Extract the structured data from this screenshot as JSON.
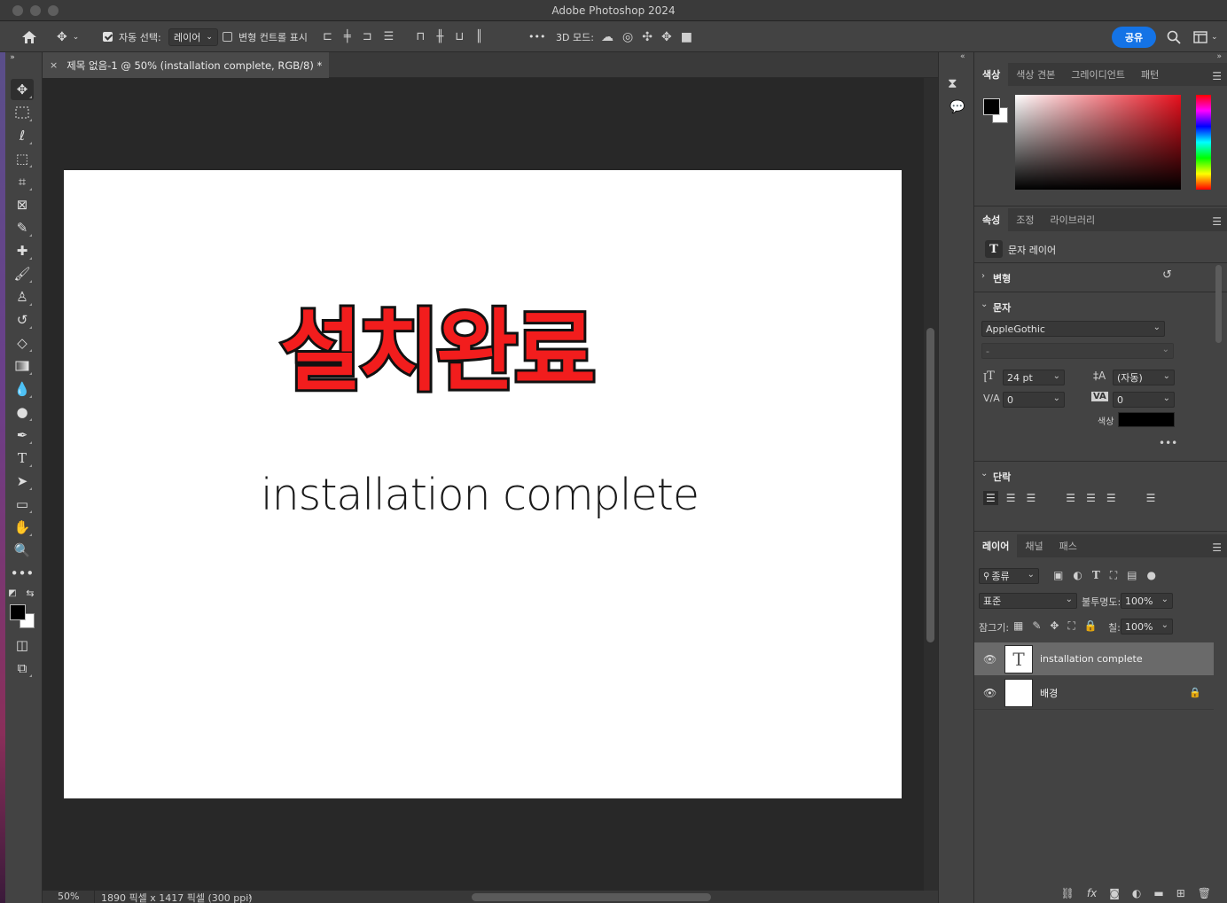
{
  "app": {
    "title": "Adobe Photoshop 2024"
  },
  "options_bar": {
    "auto_select_label": "자동 선택:",
    "auto_select_target": "레이어",
    "show_transform_label": "변형 컨트롤 표시",
    "more": "•••",
    "mode_3d_label": "3D 모드:",
    "share_label": "공유"
  },
  "document": {
    "tab_title": "제목 없음-1 @ 50% (installation complete, RGB/8) *",
    "heading_text": "설치완료",
    "subtitle_text": "installation complete",
    "zoom": "50%",
    "size_info": "1890 픽셀 x 1417 픽셀 (300 ppi)"
  },
  "color_panel": {
    "tabs": [
      "색상",
      "색상 견본",
      "그레이디언트",
      "패턴"
    ],
    "foreground": "#000000",
    "background": "#ffffff"
  },
  "properties_panel": {
    "tabs": [
      "속성",
      "조정",
      "라이브러리"
    ],
    "layer_type": "문자 레이어",
    "transform_label": "변형",
    "character_label": "문자",
    "font_family": "AppleGothic",
    "font_style": "-",
    "font_size": "24 pt",
    "leading": "(자동)",
    "kerning": "0",
    "tracking": "0",
    "color_label": "색상",
    "text_color": "#000000",
    "more": "•••",
    "paragraph_label": "단락"
  },
  "layers_panel": {
    "tabs": [
      "레이어",
      "채널",
      "패스"
    ],
    "filter_kind": "종류",
    "blend_mode": "표준",
    "opacity_label": "불투명도:",
    "opacity_value": "100%",
    "lock_label": "잠그기:",
    "fill_label": "칠:",
    "fill_value": "100%",
    "layers": [
      {
        "name": "installation complete",
        "type": "text",
        "selected": true
      },
      {
        "name": "배경",
        "type": "background",
        "locked": true
      }
    ]
  }
}
